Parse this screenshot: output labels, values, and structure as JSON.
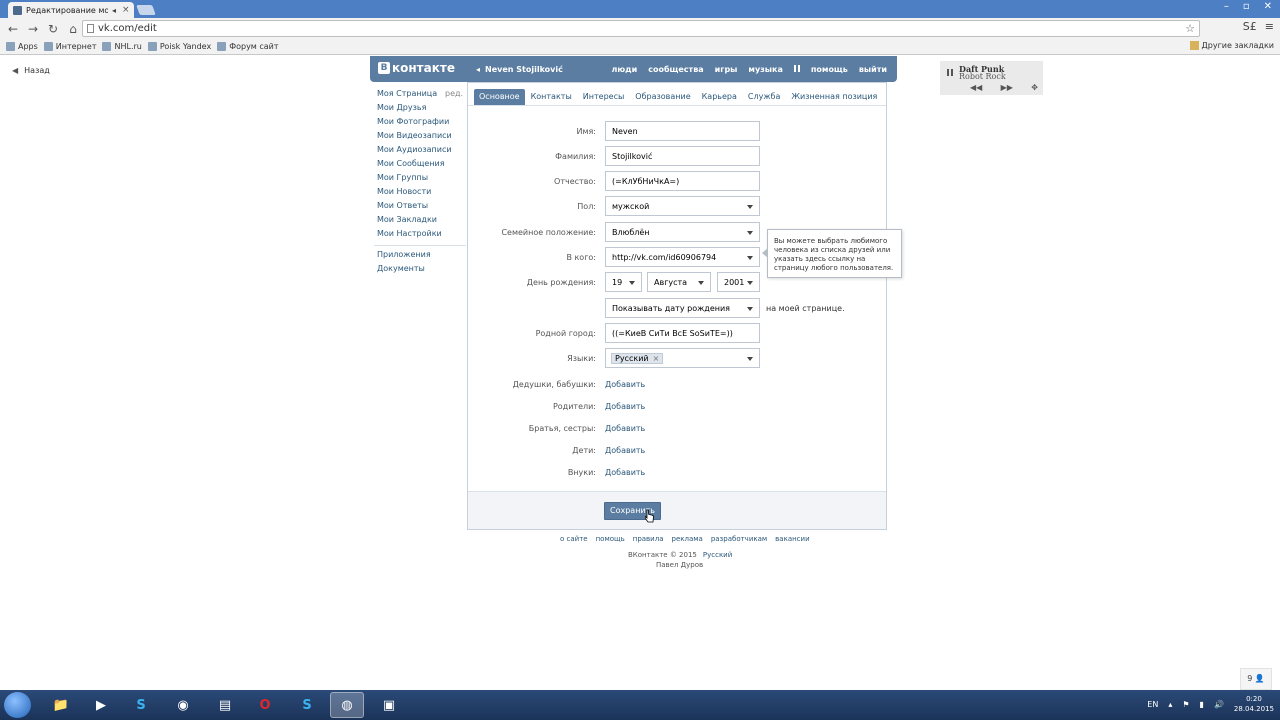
{
  "browser": {
    "tab_title": "Редактирование моей",
    "url": "vk.com/edit",
    "bookmarks": [
      "Apps",
      "Интернет",
      "NHL.ru",
      "Poisk Yandex",
      "Форум сайт"
    ],
    "bookmarks_right": "Другие закладки",
    "ext_label": "S£"
  },
  "page": {
    "back": "Назад",
    "header": {
      "logo": "контакте",
      "user": "Neven Stojilković",
      "nav": [
        "люди",
        "сообщества",
        "игры",
        "музыка",
        "помощь",
        "выйти"
      ]
    },
    "player": {
      "artist": "Daft Punk",
      "song": "Robot Rock"
    },
    "sidebar": {
      "edit": "ред.",
      "items": [
        "Моя Страница",
        "Мои Друзья",
        "Мои Фотографии",
        "Мои Видеозаписи",
        "Мои Аудиозаписи",
        "Мои Сообщения",
        "Мои Группы",
        "Мои Новости",
        "Мои Ответы",
        "Мои Закладки",
        "Мои Настройки"
      ],
      "extra": [
        "Приложения",
        "Документы"
      ]
    },
    "tabs": [
      "Основное",
      "Контакты",
      "Интересы",
      "Образование",
      "Карьера",
      "Служба",
      "Жизненная позиция"
    ],
    "form": {
      "first_name_label": "Имя:",
      "first_name": "Neven",
      "last_name_label": "Фамилия:",
      "last_name": "Stojilković",
      "patronymic_label": "Отчество:",
      "patronymic": "(=КлУбНиЧкА=)",
      "gender_label": "Пол:",
      "gender": "мужской",
      "family_label": "Семейное положение:",
      "family": "Влюблён",
      "partner_label": "В кого:",
      "partner": "http://vk.com/id60906794",
      "birthday_label": "День рождения:",
      "bday_day": "19",
      "bday_month": "Августа",
      "bday_year": "2001",
      "show_bday": "Показывать дату рождения",
      "show_bday_suffix": "на моей странице.",
      "hometown_label": "Родной город:",
      "hometown": "((=КиеВ СиТи ВсЕ SoSиТЕ=))",
      "languages_label": "Языки:",
      "language": "Русский",
      "grandparents_label": "Дедушки, бабушки:",
      "parents_label": "Родители:",
      "siblings_label": "Братья, сестры:",
      "children_label": "Дети:",
      "grandchildren_label": "Внуки:",
      "add": "Добавить"
    },
    "hint": "Вы можете выбрать любимого человека из списка друзей или указать здесь ссылку на страницу любого пользователя.",
    "save": "Сохранить",
    "footer": {
      "links": [
        "о сайте",
        "помощь",
        "правила",
        "реклама",
        "разработчикам",
        "вакансии"
      ],
      "copyright": "ВКонтакте © 2015",
      "lang": "Русский",
      "author": "Павел Дуров"
    },
    "corner_button": "9"
  },
  "taskbar": {
    "lang": "EN",
    "time": "0:20",
    "date": "28.04.2015"
  }
}
